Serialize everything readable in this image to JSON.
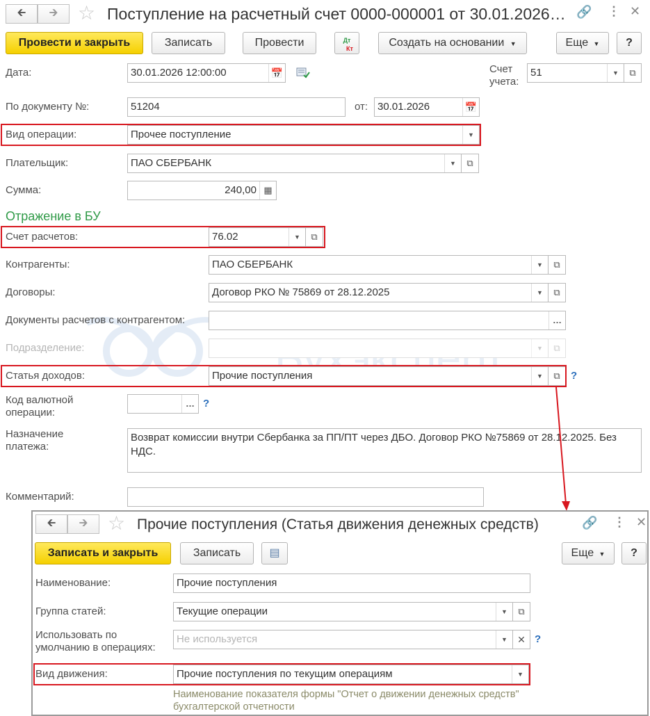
{
  "main": {
    "title": "Поступление на расчетный счет 0000-000001 от 30.01.2026…",
    "toolbar": {
      "post_close": "Провести и закрыть",
      "save": "Записать",
      "post": "Провести",
      "dtkt_dt": "Дт",
      "dtkt_kt": "Кт",
      "create_basis": "Создать на основании",
      "more": "Еще",
      "help": "?"
    },
    "fields": {
      "date_label": "Дата:",
      "date_value": "30.01.2026 12:00:00",
      "account_label_1": "Счет",
      "account_label_2": "учета:",
      "account_value": "51",
      "doc_no_label": "По документу №:",
      "doc_no_value": "51204",
      "from_label": "от:",
      "from_value": "30.01.2026",
      "op_type_label": "Вид операции:",
      "op_type_value": "Прочее поступление",
      "payer_label": "Плательщик:",
      "payer_value": "ПАО СБЕРБАНК",
      "amount_label": "Сумма:",
      "amount_value": "240,00"
    },
    "section_bu": "Отражение в БУ",
    "bu": {
      "settle_acc_label": "Счет расчетов:",
      "settle_acc_value": "76.02",
      "contractors_label": "Контрагенты:",
      "contractors_value": "ПАО СБЕРБАНК",
      "contracts_label": "Договоры:",
      "contracts_value": "Договор РКО № 75869 от 28.12.2025",
      "docs_label": "Документы расчетов с контрагентом:",
      "docs_value": "",
      "division_label": "Подразделение:",
      "division_value": "",
      "income_item_label": "Статья доходов:",
      "income_item_value": "Прочие поступления",
      "currency_code_label_1": "Код валютной",
      "currency_code_label_2": "операции:",
      "currency_code_value": "",
      "purpose_label_1": "Назначение",
      "purpose_label_2": "платежа:",
      "purpose_value": "Возврат комиссии внутри Сбербанка за ПП/ПТ через ДБО. Договор РКО №75869 от 28.12.2025. Без НДС.",
      "comment_label": "Комментарий:",
      "comment_value": ""
    },
    "watermark": "Бухэксперт"
  },
  "sub": {
    "title": "Прочие поступления (Статья движения денежных средств)",
    "toolbar": {
      "save_close": "Записать и закрыть",
      "save": "Записать",
      "more": "Еще",
      "help": "?"
    },
    "fields": {
      "name_label": "Наименование:",
      "name_value": "Прочие поступления",
      "group_label": "Группа статей:",
      "group_value": "Текущие операции",
      "default_label_1": "Использовать по",
      "default_label_2": "умолчанию в операциях:",
      "default_placeholder": "Не используется",
      "movement_label": "Вид движения:",
      "movement_value": "Прочие поступления по текущим операциям",
      "hint": "Наименование показателя формы \"Отчет о движении денежных средств\" бухгалтерской отчетности"
    }
  },
  "colors": {
    "accent_yellow": "#f5d000",
    "highlight_red": "#d8171f",
    "section_green": "#2f9a47",
    "help_blue": "#2a6ebb"
  }
}
